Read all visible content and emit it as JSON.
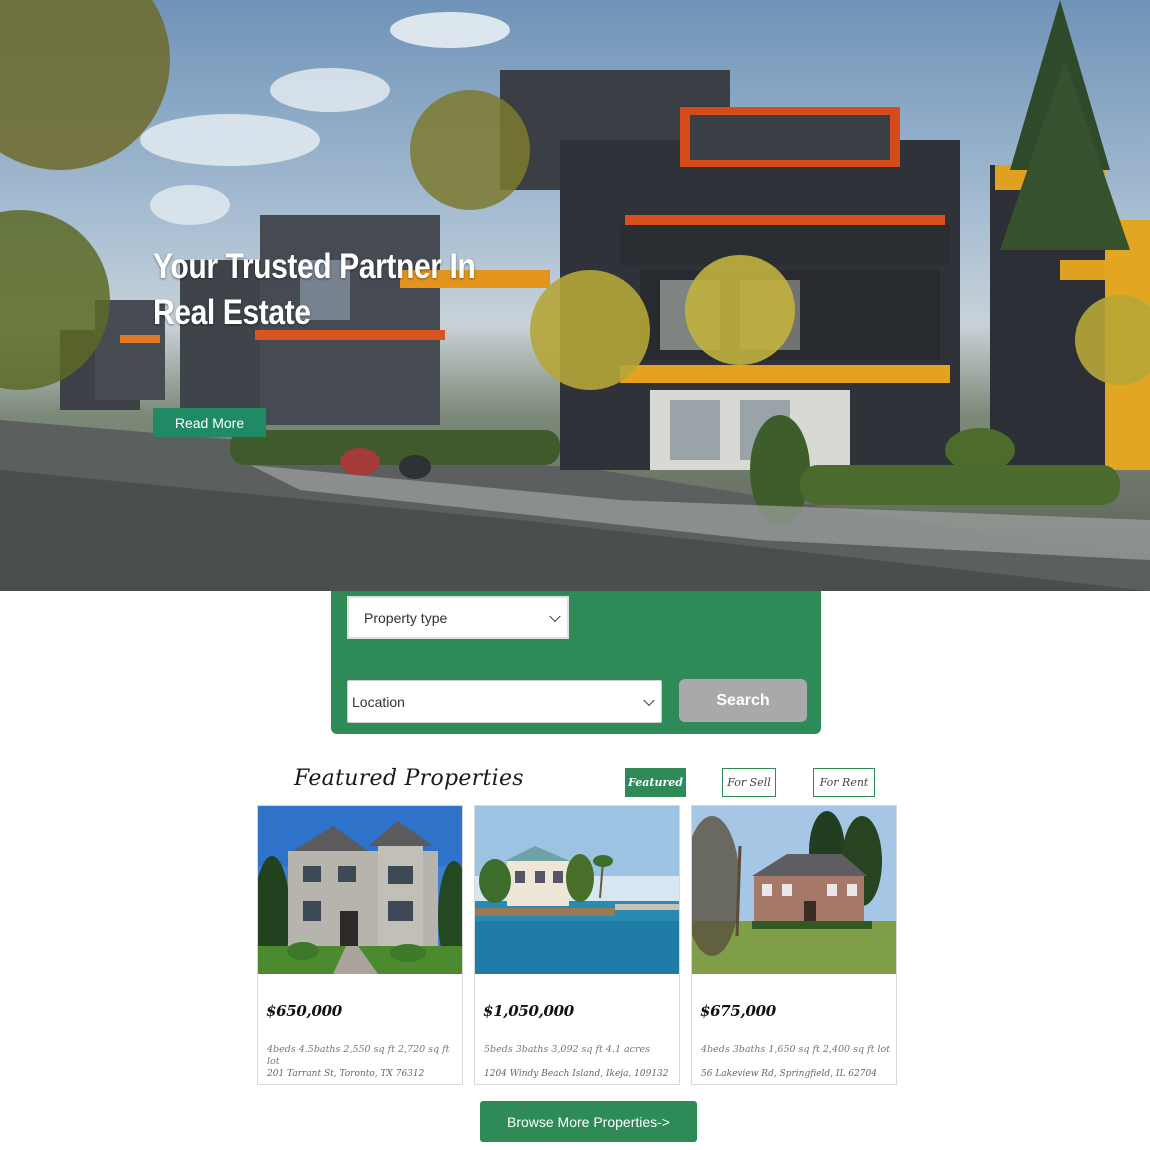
{
  "hero": {
    "title": "Your Trusted Partner In Real Estate",
    "read_more_label": "Read More"
  },
  "search": {
    "property_type_selected": "Property type",
    "location_selected": "Location",
    "search_label": "Search"
  },
  "featured": {
    "title": "Featured Properties",
    "tabs": [
      "Featured",
      "For Sell",
      "For Rent"
    ],
    "properties": [
      {
        "price": "$650,000",
        "details": "4beds 4.5baths 2,550 sq ft 2,720 sq ft lot",
        "address": "201 Tarrant St, Toronto, TX 76312"
      },
      {
        "price": "$1,050,000",
        "details": "5beds 3baths 3,092 sq ft 4.1 acres",
        "address": "1204 Windy Beach Island, Ikeja, 109132"
      },
      {
        "price": "$675,000",
        "details": "4beds 3baths 1,650 sq ft 2,400 sq ft lot",
        "address": "56 Lakeview Rd, Springfield, IL 62704"
      }
    ]
  },
  "browse_label": "Browse More Properties->",
  "colors": {
    "accent": "#2e8b57",
    "hero_button": "#1f8a63",
    "search_button": "#a9a9a9"
  }
}
